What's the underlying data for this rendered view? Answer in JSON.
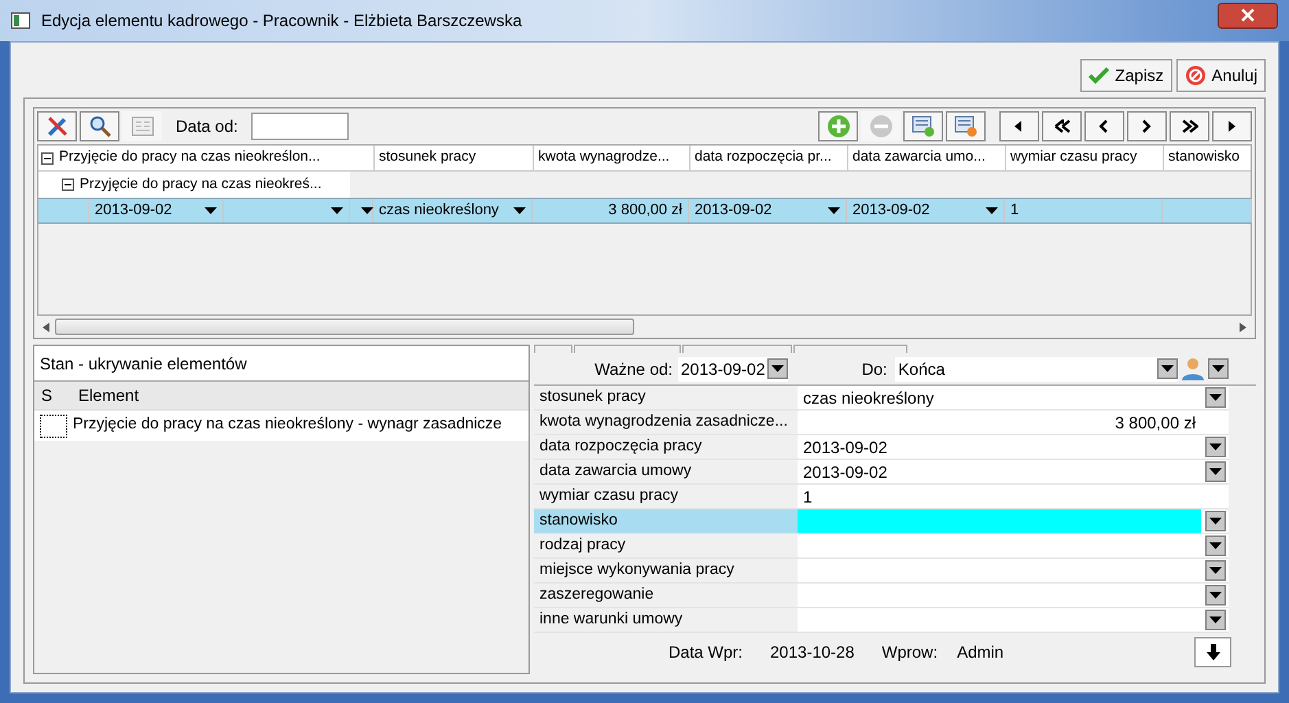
{
  "window": {
    "title": "Edycja elementu kadrowego - Pracownik - Elżbieta Barszczewska"
  },
  "buttons": [
    {
      "kind": "save",
      "label": "Zapisz"
    },
    {
      "kind": "cancel",
      "label": "Anuluj"
    }
  ],
  "toolbar": {
    "date_label": "Data od:"
  },
  "grid": {
    "columns": [
      "stosunek pracy",
      "kwota wynagrodze...",
      "data rozpoczęcia pr...",
      "data zawarcia umo...",
      "wymiar czasu pracy",
      "stanowisko"
    ],
    "tree": {
      "label": "Przyjęcie do pracy na czas nieokreślon...",
      "expanded": true,
      "children": [
        {
          "label": "Przyjęcie do pracy na czas nieokreś...",
          "expanded": true,
          "rows": [
            {
              "selected": true,
              "cells": [
                {
                  "kind": "combo",
                  "value": "2013-09-02"
                },
                {
                  "kind": "combo"
                },
                {
                  "kind": "combo"
                },
                {
                  "kind": "combo",
                  "value": "czas nieokreślony"
                },
                {
                  "kind": "money",
                  "value": "3 800,00 zł"
                },
                {
                  "kind": "combo",
                  "value": "2013-09-02"
                },
                {
                  "kind": "combo",
                  "value": "2013-09-02"
                },
                {
                  "kind": "text",
                  "value": "1"
                },
                {
                  "kind": "text"
                }
              ]
            }
          ]
        }
      ]
    }
  },
  "state_panel": {
    "title": "Stan - ukrywanie elementów",
    "columns": [
      "S",
      "Element"
    ],
    "rows": [
      {
        "checked": false,
        "label": "Przyjęcie do pracy na czas nieokreślony - wynagr zasadnicze"
      }
    ]
  },
  "details": {
    "valid_from_label": "Ważne od:",
    "valid_from": "2013-09-02",
    "valid_to_label": "Do:",
    "valid_to": "Końca",
    "rows": [
      {
        "label": "stosunek pracy",
        "kind": "combo",
        "value": "czas nieokreślony",
        "selected": false
      },
      {
        "label": "kwota wynagrodzenia zasadnicze...",
        "kind": "money",
        "value": "3 800,00 zł",
        "selected": false
      },
      {
        "label": "data rozpoczęcia pracy",
        "kind": "combo",
        "value": "2013-09-02",
        "selected": false
      },
      {
        "label": "data zawarcia umowy",
        "kind": "combo",
        "value": "2013-09-02",
        "selected": false
      },
      {
        "label": "wymiar czasu pracy",
        "kind": "text",
        "value": "1",
        "selected": false
      },
      {
        "label": "stanowisko",
        "kind": "combo",
        "selected": true
      },
      {
        "label": "rodzaj pracy",
        "kind": "combo",
        "selected": false
      },
      {
        "label": "miejsce wykonywania pracy",
        "kind": "combo",
        "selected": false
      },
      {
        "label": "zaszeregowanie",
        "kind": "combo",
        "selected": false
      },
      {
        "label": "inne warunki umowy",
        "kind": "combo",
        "selected": false
      }
    ],
    "footer": {
      "entry_date_label": "Data Wpr:",
      "entry_date": "2013-10-28",
      "entered_by_label": "Wprow:",
      "entered_by": "Admin"
    }
  }
}
